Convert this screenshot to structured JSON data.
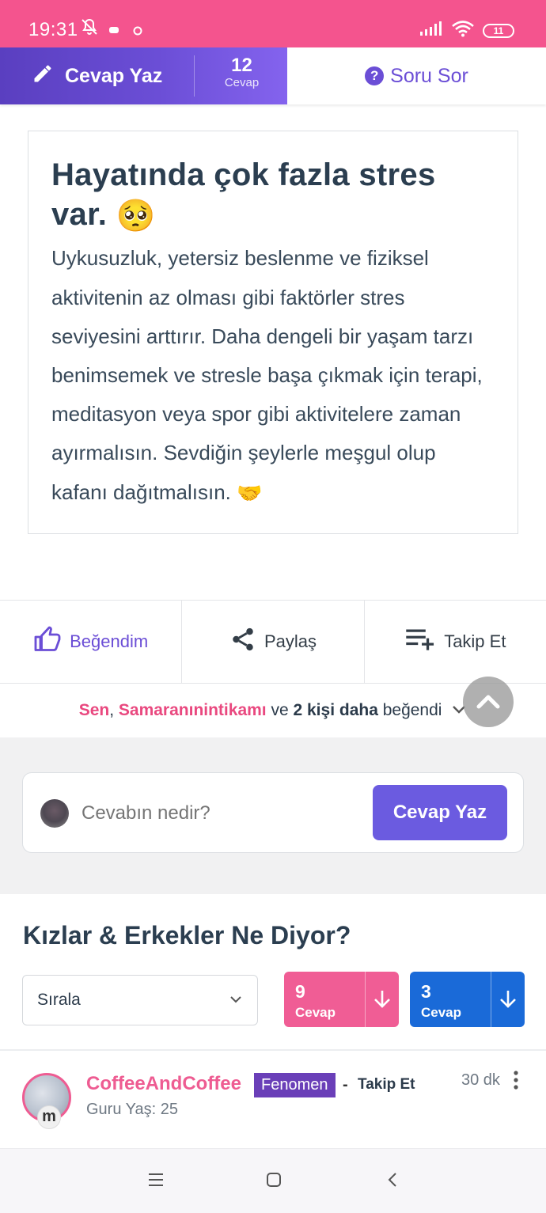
{
  "status": {
    "time": "19:31",
    "battery": "11"
  },
  "topbar": {
    "write_label": "Cevap Yaz",
    "answer_count": "12",
    "answer_count_label": "Cevap",
    "ask_label": "Soru Sor"
  },
  "answer": {
    "title": "Hayatında çok fazla stres var.",
    "title_emoji": "🥺",
    "body": "Uykusuzluk, yetersiz beslenme ve fiziksel aktivitenin az olması gibi faktörler stres seviyesini arttırır. Daha dengeli bir yaşam tarzı benimsemek ve stresle başa çıkmak için terapi, meditasyon veya spor gibi aktivitelere zaman ayırmalısın. Sevdiğin şeylerle meşgul olup kafanı dağıtmalısın.",
    "body_emoji": "🤝"
  },
  "actions": {
    "like_label": "Beğendim",
    "share_label": "Paylaş",
    "follow_label": "Takip Et"
  },
  "likers": {
    "name1": "Sen",
    "sep": ", ",
    "name2": "Samaranınintikamı",
    "and": " ve ",
    "others": "2 kişi daha",
    "suffix": " beğendi"
  },
  "compose": {
    "placeholder": "Cevabın nedir?",
    "button_label": "Cevap Yaz"
  },
  "answers_section": {
    "title": "Kızlar & Erkekler Ne Diyor?",
    "sort_label": "Sırala",
    "girls_count": "9",
    "girls_label": "Cevap",
    "boys_count": "3",
    "boys_label": "Cevap"
  },
  "first_answer": {
    "username": "CoffeeAndCoffee",
    "rank": "Fenomen",
    "dash": "-",
    "follow_label": "Takip Et",
    "meta": "Guru Yaş: 25",
    "time": "30 dk",
    "badge_letter": "m"
  },
  "colors": {
    "status_bar": "#f4548e",
    "purple": "#6b4ed6",
    "pink": "#f05d95",
    "blue": "#1a6ad8"
  }
}
